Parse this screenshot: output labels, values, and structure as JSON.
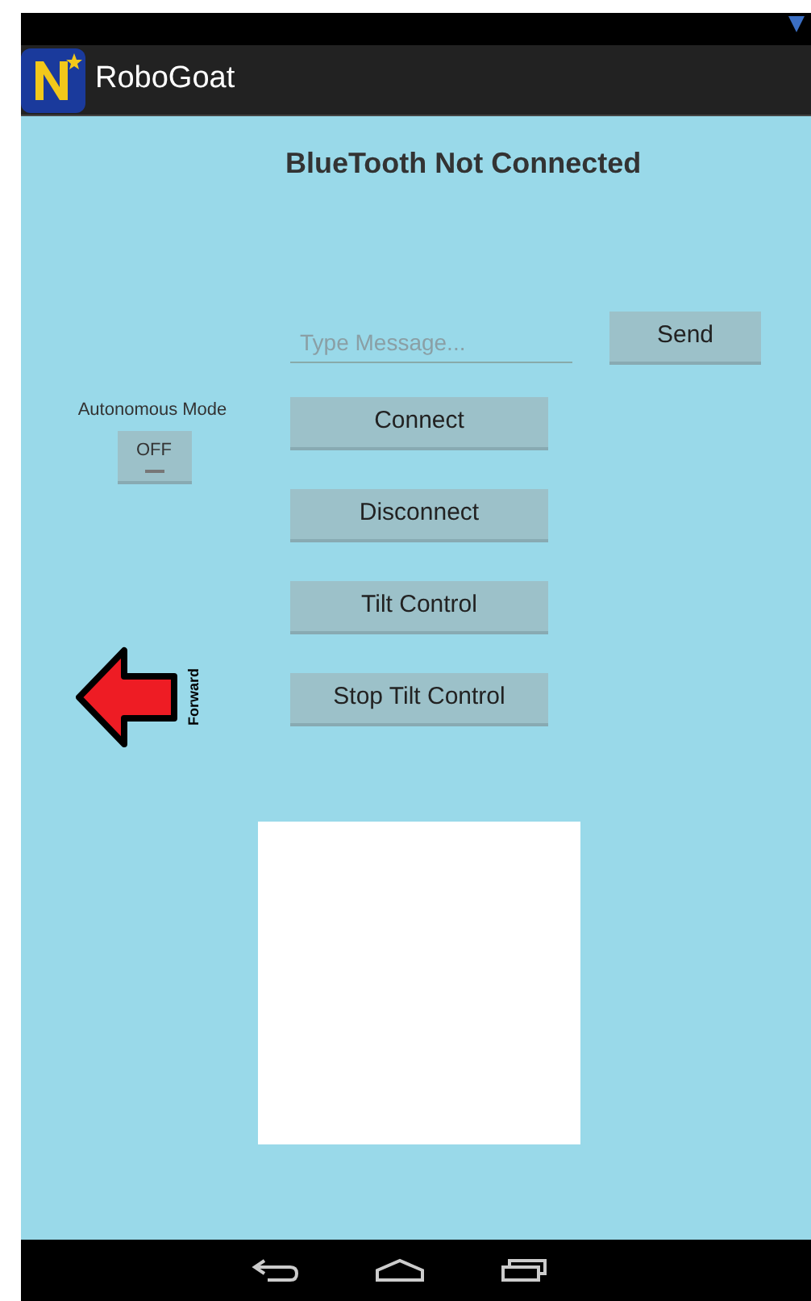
{
  "app_bar": {
    "title": "RoboGoat"
  },
  "status_text": "BlueTooth Not Connected",
  "message_field": {
    "placeholder": "Type Message..."
  },
  "send_button": "Send",
  "autonomous_mode": {
    "label": "Autonomous Mode",
    "toggle_text": "OFF",
    "on": false
  },
  "buttons": [
    "Connect",
    "Disconnect",
    "Tilt Control",
    "Stop Tilt Control"
  ],
  "direction": {
    "label": "Forward"
  }
}
